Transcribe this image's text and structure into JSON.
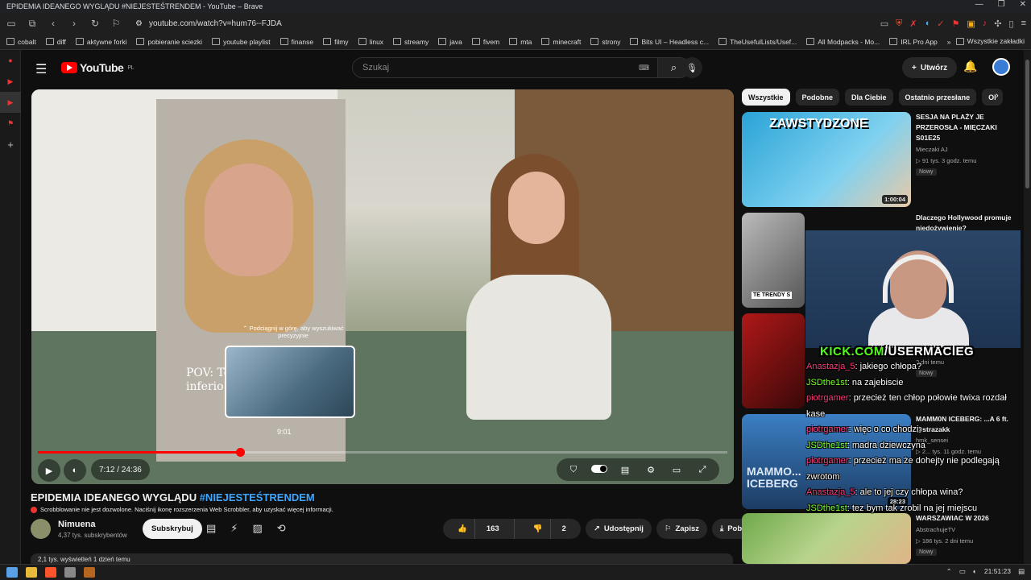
{
  "window": {
    "title": "EPIDEMIA IDEANEGO WYGLĄDU #NIEJESTEŚTRENDEM - YouTube – Brave"
  },
  "browser": {
    "url": "youtube.com/watch?v=hum76--FJDA",
    "bookmarks": [
      "cobalt",
      "diff",
      "aktywne forki",
      "pobieranie sciezki",
      "youtube playlist",
      "finanse",
      "filmy",
      "linux",
      "streamy",
      "java",
      "fivem",
      "mta",
      "minecraft",
      "strony",
      "Bits UI – Headless c...",
      "TheUsefulLists/Usef...",
      "All Modpacks - Mo...",
      "IRL Pro App"
    ],
    "bookmarks_more": "»",
    "all_bookmarks": "Wszystkie zakładki"
  },
  "yt": {
    "logo": "YouTube",
    "region": "PL",
    "search_placeholder": "Szukaj",
    "create_label": "Utwórz"
  },
  "player": {
    "seek_hint": "⌃ Podciągnij w górę, aby wyszukiwać precyzyjnie",
    "overlay_text": "POV: Te\ninferio",
    "preview_time": "9:01",
    "time": "7:12 / 24:36",
    "progress": 0.293,
    "hover_position": 0.366
  },
  "video": {
    "title_main": "EPIDEMIA IDEANEGO WYGLĄDU ",
    "title_tag": "#NIEJESTEŚTRENDEM",
    "scrobble_notice": "Scrobblowanie nie jest dozwolone. Naciśnij ikonę rozszerzenia Web Scrobbler, aby uzyskać więcej informacji.",
    "channel": "Nimuena",
    "subs": "4,37 tys. subskrybentów",
    "subscribe": "Subskrybuj",
    "likes": "163",
    "dislikes": "2",
    "share": "Udostępnij",
    "save": "Zapisz",
    "download": "Pobierz",
    "views_line": "2,1 tys. wyświetleń  1 dzień temu"
  },
  "chips": [
    "Wszystkie",
    "Podobne",
    "Dla Ciebie",
    "Ostatnio przesłane",
    "Ol"
  ],
  "recommendations": [
    {
      "title": "SESJA NA PLAŻY JE PRZEROSŁA - MIĘCZAKI S01E25",
      "channel": "Mieczaki AJ",
      "meta": "▷ 91 tys.  3 godz. temu",
      "badge": "Nowy",
      "duration": "1:00:04",
      "thumb_text": "ZAWSTYDZONE"
    },
    {
      "title": "Dlaczego Hollywood promuje niedożywienie?",
      "channel": "",
      "meta": "",
      "badge": "",
      "duration": "",
      "thumb_text": "TE TRENDY S"
    },
    {
      "title": "",
      "channel": "",
      "meta": "2 dni temu",
      "badge": "Nowy",
      "duration": "",
      "thumb_text": ""
    },
    {
      "title": "MAMM0N ICEBERG: ...A 6 ft. @strazakk",
      "channel": "hmk_sensei",
      "meta": "▷ 2... tys.  11 godz. temu",
      "badge": "",
      "duration": "28:23",
      "thumb_text": "MAMMO... ICEBERG"
    },
    {
      "title": "WARSZAWIAC W 2026",
      "channel": "AbstrachujeTV",
      "meta": "▷ 186 tys.  2 dni temu",
      "badge": "Nowy",
      "duration": "",
      "thumb_text": ""
    }
  ],
  "overlay": {
    "kick_prefix": "KICK.COM",
    "kick_user": "/USERMACIEG",
    "chat": [
      {
        "user": "Anastazja_5",
        "color": "#ff3b7a",
        "msg": ": jakiego chłopa?"
      },
      {
        "user": "JSDthe1st",
        "color": "#7dff2e",
        "msg": ": na zajebiscie"
      },
      {
        "user": "piotrgamer",
        "color": "#ff3b7a",
        "msg": ": przecież ten chłop połowie twixa rozdał kase"
      },
      {
        "user": "piotrgamer",
        "color": "#ff3b7a",
        "msg": ": więc o co chodzi"
      },
      {
        "user": "JSDthe1st",
        "color": "#7dff2e",
        "msg": ": madra dziewczyna"
      },
      {
        "user": "piotrgamer",
        "color": "#ff3b7a",
        "msg": ": przecież ma że dohejty nie podlegają zwrotom"
      },
      {
        "user": "Anastazja_5",
        "color": "#ff3b7a",
        "msg": ": ale to jej czy chłopa wina?"
      },
      {
        "user": "JSDthe1st",
        "color": "#7dff2e",
        "msg": ": tez bym tak zrobil na jej miejscu"
      }
    ]
  },
  "taskbar": {
    "clock": "21:51:23"
  },
  "colors": {
    "accent": "#ff0000",
    "link": "#3ea6ff",
    "bg": "#0f0f0f"
  }
}
